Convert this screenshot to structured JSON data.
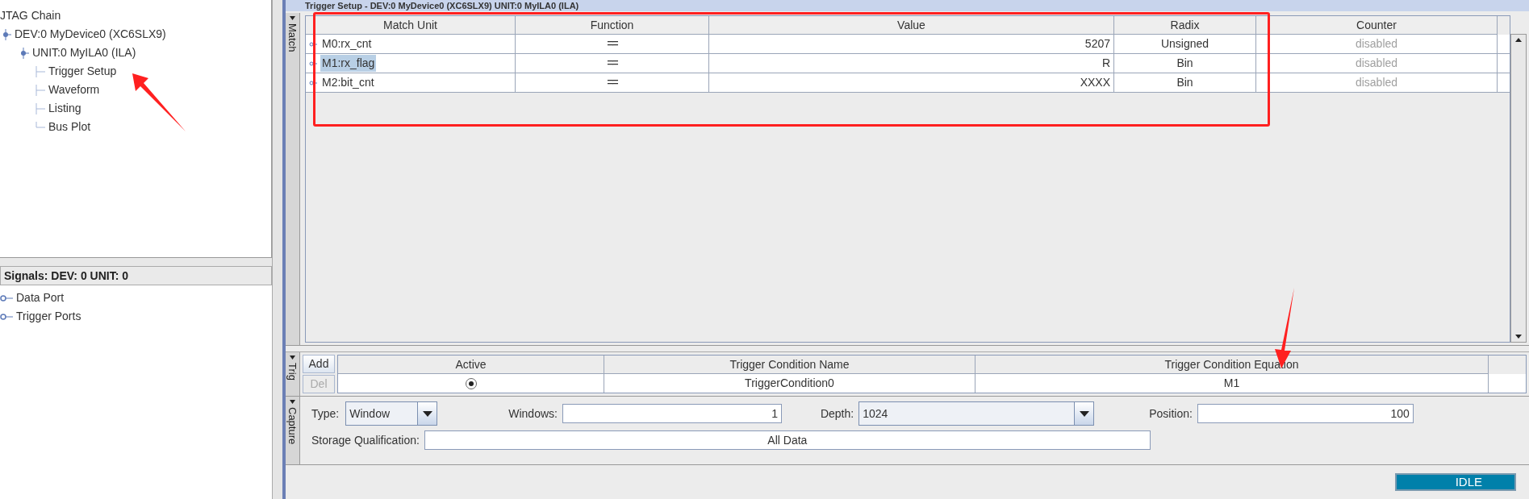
{
  "tree": {
    "root": "JTAG Chain",
    "children": [
      {
        "label": "DEV:0 MyDevice0 (XC6SLX9)",
        "children": [
          {
            "label": "UNIT:0 MyILA0 (ILA)",
            "children": [
              {
                "label": "Trigger Setup"
              },
              {
                "label": "Waveform"
              },
              {
                "label": "Listing"
              },
              {
                "label": "Bus Plot"
              }
            ]
          }
        ]
      }
    ]
  },
  "signals": {
    "title": "Signals: DEV: 0 UNIT: 0",
    "items": [
      "Data Port",
      "Trigger Ports"
    ]
  },
  "window": {
    "title": "Trigger Setup - DEV:0 MyDevice0 (XC6SLX9) UNIT:0 MyILA0 (ILA)"
  },
  "match": {
    "tab": "Match",
    "columns": [
      "Match Unit",
      "Function",
      "Value",
      "Radix",
      "Counter"
    ],
    "rows": [
      {
        "unit": "M0:rx_cnt",
        "function": "==",
        "value": "5207",
        "radix": "Unsigned",
        "counter": "disabled",
        "selected": false
      },
      {
        "unit": "M1:rx_flag",
        "function": "==",
        "value": "R",
        "radix": "Bin",
        "counter": "disabled",
        "selected": true
      },
      {
        "unit": "M2:bit_cnt",
        "function": "==",
        "value": "XXXX",
        "radix": "Bin",
        "counter": "disabled",
        "selected": false
      }
    ]
  },
  "trig": {
    "tab": "Trig",
    "buttons": [
      {
        "label": "Add",
        "disabled": false
      },
      {
        "label": "Del",
        "disabled": true
      }
    ],
    "columns": [
      "Active",
      "Trigger Condition Name",
      "Trigger Condition Equation"
    ],
    "rows": [
      {
        "active": true,
        "name": "TriggerCondition0",
        "equation": "M1"
      }
    ]
  },
  "capture": {
    "tab": "Capture",
    "type_label": "Type:",
    "type_value": "Window",
    "windows_label": "Windows:",
    "windows_value": "1",
    "depth_label": "Depth:",
    "depth_value": "1024",
    "position_label": "Position:",
    "position_value": "100",
    "storage_label": "Storage Qualification:",
    "storage_value": "All Data"
  },
  "status": {
    "state": "IDLE"
  }
}
